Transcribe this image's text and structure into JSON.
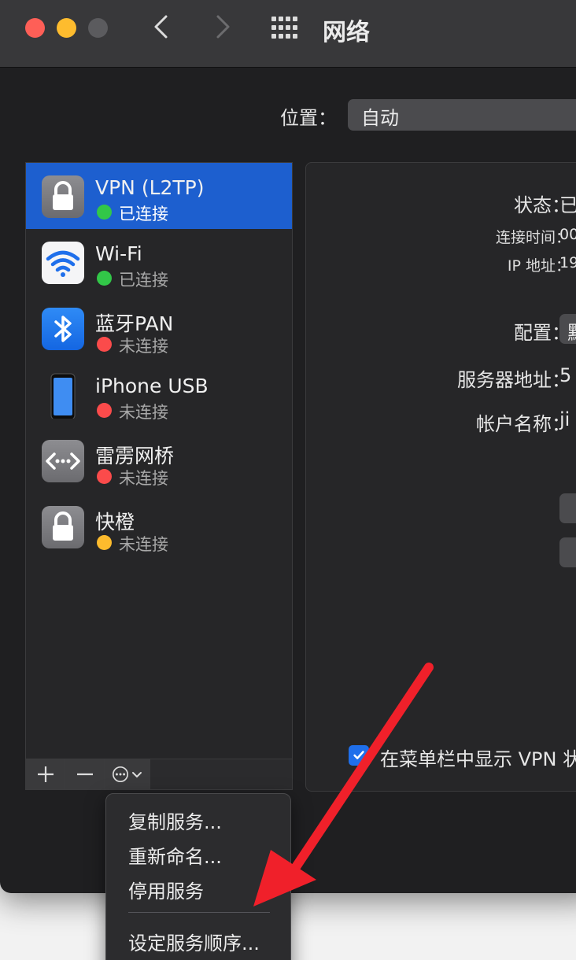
{
  "window": {
    "title": "网络"
  },
  "location": {
    "label": "位置：",
    "value": "自动"
  },
  "services": [
    {
      "name": "VPN (L2TP)",
      "status": "已连接",
      "status_color": "#32c748",
      "icon": "lock-icon",
      "selected": true
    },
    {
      "name": "Wi-Fi",
      "status": "已连接",
      "status_color": "#32c748",
      "icon": "wifi-icon",
      "selected": false
    },
    {
      "name": "蓝牙PAN",
      "status": "未连接",
      "status_color": "#fb4b4b",
      "icon": "bluetooth-icon",
      "selected": false
    },
    {
      "name": "iPhone USB",
      "status": "未连接",
      "status_color": "#fb4b4b",
      "icon": "iphone-icon",
      "selected": false
    },
    {
      "name": "雷雳网桥",
      "status": "未连接",
      "status_color": "#fb4b4b",
      "icon": "thunderbolt-bridge-icon",
      "selected": false
    },
    {
      "name": "快橙",
      "status": "未连接",
      "status_color": "#fdbb2d",
      "icon": "lock-icon",
      "selected": false
    }
  ],
  "toolbar": {
    "add": "+",
    "remove": "—"
  },
  "detail": {
    "status_label": "状态：",
    "status_value": "已",
    "connect_time_label": "连接时间：",
    "connect_time_value": "00",
    "ip_label": "IP 地址：",
    "ip_value": "19",
    "config_label": "配置：",
    "config_value": "默",
    "server_label": "服务器地址：",
    "server_value": "5",
    "account_label": "帐户名称：",
    "account_value": "ji",
    "show_vpn_label": "在菜单栏中显示 VPN 状",
    "show_vpn_checked": true
  },
  "context_menu": {
    "items": [
      "复制服务...",
      "重新命名...",
      "停用服务",
      "设定服务顺序..."
    ]
  },
  "colors": {
    "accent": "#1d5fcf",
    "annotation_arrow": "#f0202a"
  }
}
